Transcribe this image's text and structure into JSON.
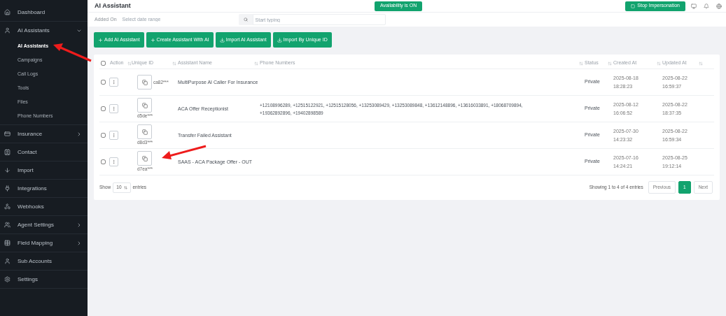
{
  "sidebar": {
    "items": [
      {
        "label": "Dashboard",
        "kind": "link"
      },
      {
        "label": "AI Assistants",
        "kind": "group",
        "expanded": true,
        "children": [
          {
            "label": "AI Assistants",
            "selected": true
          },
          {
            "label": "Campaigns",
            "selected": false
          },
          {
            "label": "Call Logs",
            "selected": false
          },
          {
            "label": "Tools",
            "selected": false
          },
          {
            "label": "Files",
            "selected": false
          },
          {
            "label": "Phone Numbers",
            "selected": false
          }
        ]
      },
      {
        "label": "Insurance",
        "kind": "group",
        "expanded": false
      },
      {
        "label": "Contact",
        "kind": "link"
      },
      {
        "label": "Import",
        "kind": "link"
      },
      {
        "label": "Integrations",
        "kind": "link"
      },
      {
        "label": "Webhooks",
        "kind": "link"
      },
      {
        "label": "Agent Settings",
        "kind": "group",
        "expanded": false
      },
      {
        "label": "Field Mapping",
        "kind": "group",
        "expanded": false
      },
      {
        "label": "Sub Accounts",
        "kind": "link"
      },
      {
        "label": "Settings",
        "kind": "link"
      }
    ]
  },
  "header": {
    "title": "AI Assistant",
    "availability_button": "Availability is ON",
    "impersonation_button": "Stop Impersonation"
  },
  "filters": {
    "date_label": "Added On",
    "date_placeholder": "Select date range",
    "search_placeholder": "Start typing"
  },
  "actions": [
    "Add AI Assistant",
    "Create Assistant With AI",
    "Import AI Assistant",
    "Import By Unique ID"
  ],
  "table": {
    "select_all_checked": false,
    "columns": [
      "Action",
      "Unique ID",
      "Assistant Name",
      "Phone Numbers",
      "Status",
      "Created At",
      "Updated At"
    ],
    "rows": [
      {
        "checked": false,
        "unique_id": "ca82***",
        "name": "MultiPurpose AI Caller For Insurance",
        "phones": "",
        "status": "Private",
        "created": "2025-08-18 18:28:23",
        "updated": "2025-08-22 16:59:37"
      },
      {
        "checked": false,
        "unique_id": "d5de***",
        "name": "ACA Offer Receptionist",
        "phones": "+12108996289, +12515122921, +12515128056, +13253089429, +13253089848, +13612148896, +13616033891, +18068709894, +19362892896, +19402898589",
        "status": "Private",
        "created": "2025-08-12 16:06:52",
        "updated": "2025-08-22 18:37:35"
      },
      {
        "checked": false,
        "unique_id": "d8d3***",
        "name": "Transfer Failed Assistant",
        "phones": "",
        "status": "Private",
        "created": "2025-07-30 14:23:32",
        "updated": "2025-08-22 16:59:34"
      },
      {
        "checked": false,
        "unique_id": "d7ea***",
        "name": "SAAS - ACA Package Offer - OUT",
        "phones": "",
        "status": "Private",
        "created": "2025-07-16 14:24:21",
        "updated": "2025-08-25 19:12:14"
      }
    ]
  },
  "footer": {
    "show_label": "Show",
    "page_size": "10",
    "entries_label": "entries",
    "summary": "Showing 1 to 4 of 4 entries",
    "pages": [
      {
        "label": "Previous",
        "selected": false
      },
      {
        "label": "1",
        "selected": true
      },
      {
        "label": "Next",
        "selected": false
      }
    ]
  }
}
